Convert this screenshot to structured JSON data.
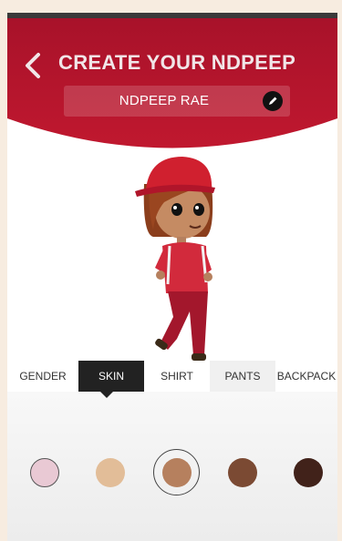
{
  "header": {
    "title": "CREATE YOUR NDPEEP",
    "name": "NDPEEP RAE",
    "back_icon": "chevron-left-icon",
    "edit_icon": "pencil-icon"
  },
  "tabs": [
    {
      "label": "GENDER",
      "active": false
    },
    {
      "label": "SKIN",
      "active": true
    },
    {
      "label": "SHIRT",
      "active": false
    },
    {
      "label": "PANTS",
      "active": false
    },
    {
      "label": "BACKPACK",
      "active": false
    }
  ],
  "skin_swatches": [
    {
      "color": "#e9c9d4",
      "selected": false
    },
    {
      "color": "#e2bd98",
      "selected": false
    },
    {
      "color": "#b6805e",
      "selected": true
    },
    {
      "color": "#7b4a33",
      "selected": false
    },
    {
      "color": "#41221a",
      "selected": false
    }
  ],
  "colors": {
    "brand_red": "#b5152b",
    "shirt_red": "#d22a3c",
    "pants_red": "#a3172c"
  }
}
